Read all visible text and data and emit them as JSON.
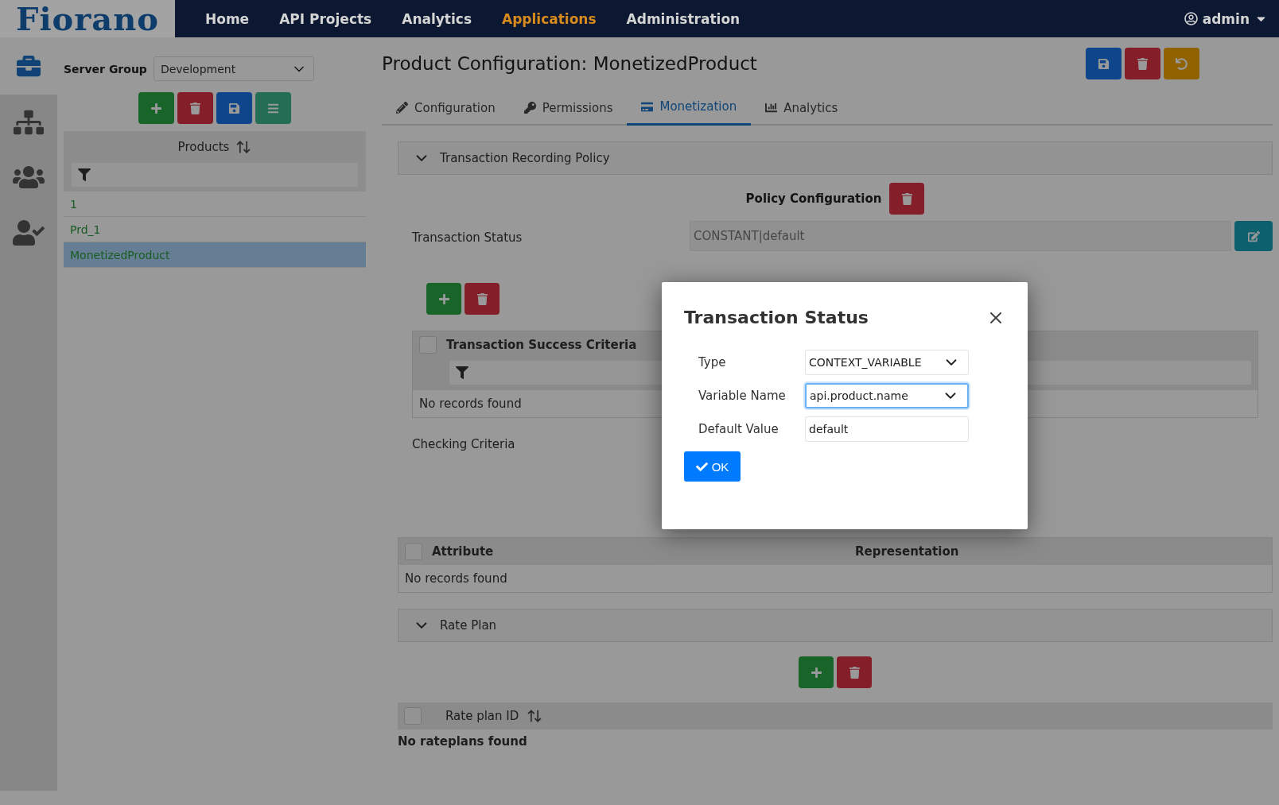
{
  "brand": "Fiorano",
  "nav": [
    {
      "label": "Home",
      "selected": false
    },
    {
      "label": "API Projects",
      "selected": false
    },
    {
      "label": "Analytics",
      "selected": false
    },
    {
      "label": "Applications",
      "selected": true
    },
    {
      "label": "Administration",
      "selected": false
    }
  ],
  "user": "admin",
  "server_group": {
    "label": "Server Group",
    "value": "Development"
  },
  "products": {
    "header": "Products",
    "items": [
      {
        "label": "1",
        "selected": false
      },
      {
        "label": "Prd_1",
        "selected": false
      },
      {
        "label": "MonetizedProduct",
        "selected": true
      }
    ]
  },
  "page_title": "Product Configuration: MonetizedProduct",
  "tabs": [
    {
      "label": "Configuration",
      "kind": "pencil",
      "selected": false
    },
    {
      "label": "Permissions",
      "kind": "key",
      "selected": false
    },
    {
      "label": "Monetization",
      "kind": "card",
      "selected": true
    },
    {
      "label": "Analytics",
      "kind": "chart",
      "selected": false
    }
  ],
  "transaction_policy": {
    "title": "Transaction Recording Policy",
    "expanded": true,
    "policy_label": "Policy Configuration",
    "status_label": "Transaction Status",
    "status_value": "CONSTANT|default",
    "criteria_header": "Transaction Success Criteria",
    "criteria_checked": false,
    "criteria_empty": "No records found",
    "checking_label": "Checking Criteria"
  },
  "attributes": {
    "columns": [
      "Attribute",
      "Representation"
    ],
    "checked": false,
    "empty": "No records found"
  },
  "rate_plan": {
    "title": "Rate Plan",
    "expanded": true,
    "column": "Rate plan ID",
    "checked": false,
    "empty": "No rateplans found"
  },
  "dialog": {
    "title": "Transaction Status",
    "fields": [
      {
        "label": "Type",
        "kind": "select",
        "value": "CONTEXT_VARIABLE",
        "focused": false
      },
      {
        "label": "Variable Name",
        "kind": "select",
        "value": "api.product.name",
        "focused": true
      },
      {
        "label": "Default Value",
        "kind": "text",
        "value": "default",
        "focused": false
      }
    ],
    "ok": "OK"
  }
}
